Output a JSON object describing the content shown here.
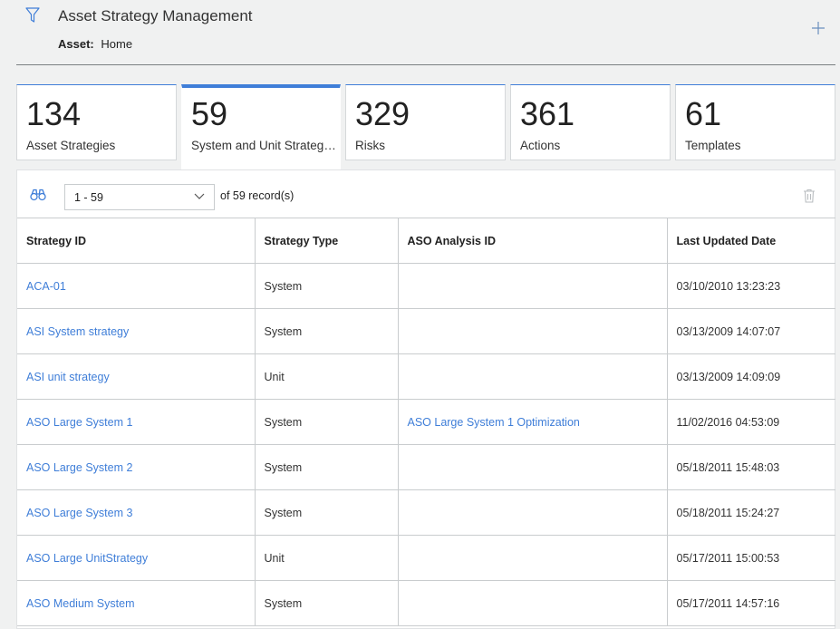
{
  "header": {
    "title": "Asset Strategy Management",
    "asset_label": "Asset:",
    "asset_value": "Home",
    "filter_icon": "filter-icon",
    "add_icon": "plus-icon"
  },
  "tiles": [
    {
      "count": "134",
      "label": "Asset Strategies",
      "active": false
    },
    {
      "count": "59",
      "label": "System and Unit Strategi...",
      "active": true
    },
    {
      "count": "329",
      "label": "Risks",
      "active": false
    },
    {
      "count": "361",
      "label": "Actions",
      "active": false
    },
    {
      "count": "61",
      "label": "Templates",
      "active": false
    }
  ],
  "toolbar": {
    "search_icon": "binoculars-icon",
    "range_value": "1 - 59",
    "records_text": "of 59 record(s)",
    "delete_icon": "trash-icon"
  },
  "table": {
    "columns": [
      "Strategy ID",
      "Strategy Type",
      "ASO Analysis ID",
      "Last Updated Date"
    ],
    "rows": [
      {
        "id": "ACA-01",
        "type": "System",
        "aso": "",
        "date": "03/10/2010 13:23:23"
      },
      {
        "id": "ASI System strategy",
        "type": "System",
        "aso": "",
        "date": "03/13/2009 14:07:07"
      },
      {
        "id": "ASI unit strategy",
        "type": "Unit",
        "aso": "",
        "date": "03/13/2009 14:09:09"
      },
      {
        "id": "ASO Large System 1",
        "type": "System",
        "aso": "ASO Large System 1 Optimization",
        "date": "11/02/2016 04:53:09"
      },
      {
        "id": "ASO Large System 2",
        "type": "System",
        "aso": "",
        "date": "05/18/2011 15:48:03"
      },
      {
        "id": "ASO Large System 3",
        "type": "System",
        "aso": "",
        "date": "05/18/2011 15:24:27"
      },
      {
        "id": "ASO Large UnitStrategy",
        "type": "Unit",
        "aso": "",
        "date": "05/17/2011 15:00:53"
      },
      {
        "id": "ASO Medium System",
        "type": "System",
        "aso": "",
        "date": "05/17/2011 14:57:16"
      }
    ]
  },
  "colors": {
    "accent": "#3f7ed8",
    "background": "#f0f1f1",
    "border": "#c9ccce"
  }
}
